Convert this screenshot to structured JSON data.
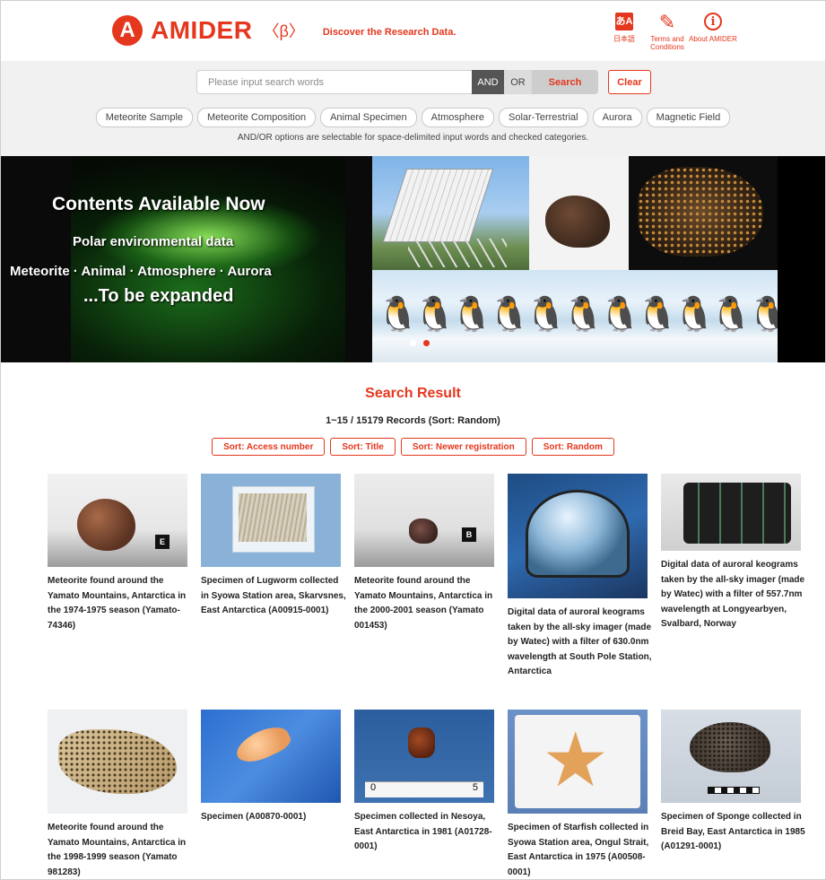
{
  "header": {
    "logo_mark": "A",
    "logo_text": "AMIDER",
    "beta": "〈β〉",
    "tagline": "Discover the Research Data.",
    "links": [
      {
        "icon": "japanese-language-icon",
        "glyph": "あA",
        "label": "日本語"
      },
      {
        "icon": "pen-icon",
        "glyph": "✎",
        "label": "Terms and Conditions"
      },
      {
        "icon": "info-icon",
        "glyph": "i",
        "label": "About AMIDER"
      }
    ]
  },
  "search": {
    "placeholder": "Please input search words",
    "value": "",
    "and_label": "AND",
    "or_label": "OR",
    "search_label": "Search",
    "clear_label": "Clear",
    "categories": [
      "Meteorite Sample",
      "Meteorite Composition",
      "Animal Specimen",
      "Atmosphere",
      "Solar-Terrestrial",
      "Aurora",
      "Magnetic Field"
    ],
    "note": "AND/OR options are selectable for space-delimited input words and checked categories."
  },
  "banner": {
    "line1": "Contents Available Now",
    "line2": "Polar environmental data",
    "line3": "Meteorite · Animal · Atmosphere · Aurora",
    "line4": "...To be expanded",
    "active_slide": 2,
    "slide_count": 2
  },
  "results": {
    "title": "Search Result",
    "count": "1~15 / 15179 Records (Sort: Random)",
    "sort_buttons": [
      "Sort: Access number",
      "Sort: Title",
      "Sort: Newer registration",
      "Sort: Random"
    ],
    "items": [
      {
        "caption": "Meteorite found around the Yamato Mountains, Antarctica in the 1974-1975 season (Yamato-74346)",
        "thumb_label": "E"
      },
      {
        "caption": "Specimen of Lugworm collected in Syowa Station area, Skarvsnes, East Antarctica (A00915-0001)"
      },
      {
        "caption": "Meteorite found around the Yamato Mountains, Antarctica in the 2000-2001 season (Yamato 001453)",
        "thumb_label": "B"
      },
      {
        "caption": "Digital data of auroral keograms taken by the all-sky imager (made by Watec) with a filter of 630.0nm wavelength at South Pole Station, Antarctica"
      },
      {
        "caption": "Digital data of auroral keograms taken by the all-sky imager (made by Watec) with a filter of 557.7nm wavelength at Longyearbyen, Svalbard, Norway"
      },
      {
        "caption": "Meteorite found around the Yamato Mountains, Antarctica in the 1998-1999 season (Yamato 981283)"
      },
      {
        "caption": "Specimen (A00870-0001)"
      },
      {
        "caption": "Specimen collected in Nesoya, East Antarctica in 1981 (A01728-0001)",
        "ruler_start": "0",
        "ruler_end": "5"
      },
      {
        "caption": "Specimen of Starfish collected in Syowa Station area, Ongul Strait, East Antarctica in 1975 (A00508-0001)"
      },
      {
        "caption": "Specimen of Sponge collected in Breid Bay, East Antarctica in 1985 (A01291-0001)"
      }
    ]
  }
}
